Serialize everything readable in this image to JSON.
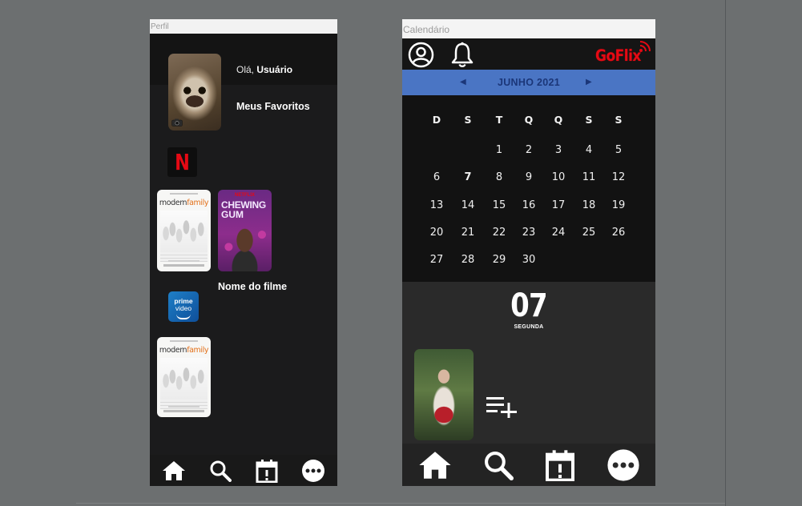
{
  "perfil": {
    "window_title": "Perfil",
    "greeting_prefix": "Olá, ",
    "greeting_name": "Usuário",
    "favorites_title": "Meus Favoritos",
    "netflix_logo": "N",
    "poster_modern_family": {
      "title_a": "modern",
      "title_b": "family"
    },
    "poster_chewing_gum": {
      "brand": "NETFLIX",
      "title_line1": "CHEWING",
      "title_line2": "GUM"
    },
    "movie_name": "Nome do filme",
    "prime_logo": {
      "line1": "prime",
      "line2": "video"
    },
    "nav": [
      "home-icon",
      "search-icon",
      "calendar-icon",
      "more-icon"
    ]
  },
  "calendario": {
    "window_title": "Calendário",
    "brand": "GoFlix",
    "month_label": "JUNHO 2021",
    "weekdays": [
      "D",
      "S",
      "T",
      "Q",
      "Q",
      "S",
      "S"
    ],
    "weeks": [
      [
        "",
        "",
        "1",
        "2",
        "3",
        "4",
        "5"
      ],
      [
        "6",
        "7",
        "8",
        "9",
        "10",
        "11",
        "12"
      ],
      [
        "13",
        "14",
        "15",
        "16",
        "17",
        "18",
        "19"
      ],
      [
        "20",
        "21",
        "22",
        "23",
        "24",
        "25",
        "26"
      ],
      [
        "27",
        "28",
        "29",
        "30",
        "",
        "",
        ""
      ]
    ],
    "selected_day": "7",
    "selected_date_big": "07",
    "selected_weekday": "SEGUNDA",
    "nav": [
      "home-icon",
      "search-icon",
      "calendar-icon",
      "more-icon"
    ]
  },
  "colors": {
    "month_bar": "#4a75c4",
    "brand_red": "#e50914",
    "dark_bg": "#1e1e1f"
  }
}
